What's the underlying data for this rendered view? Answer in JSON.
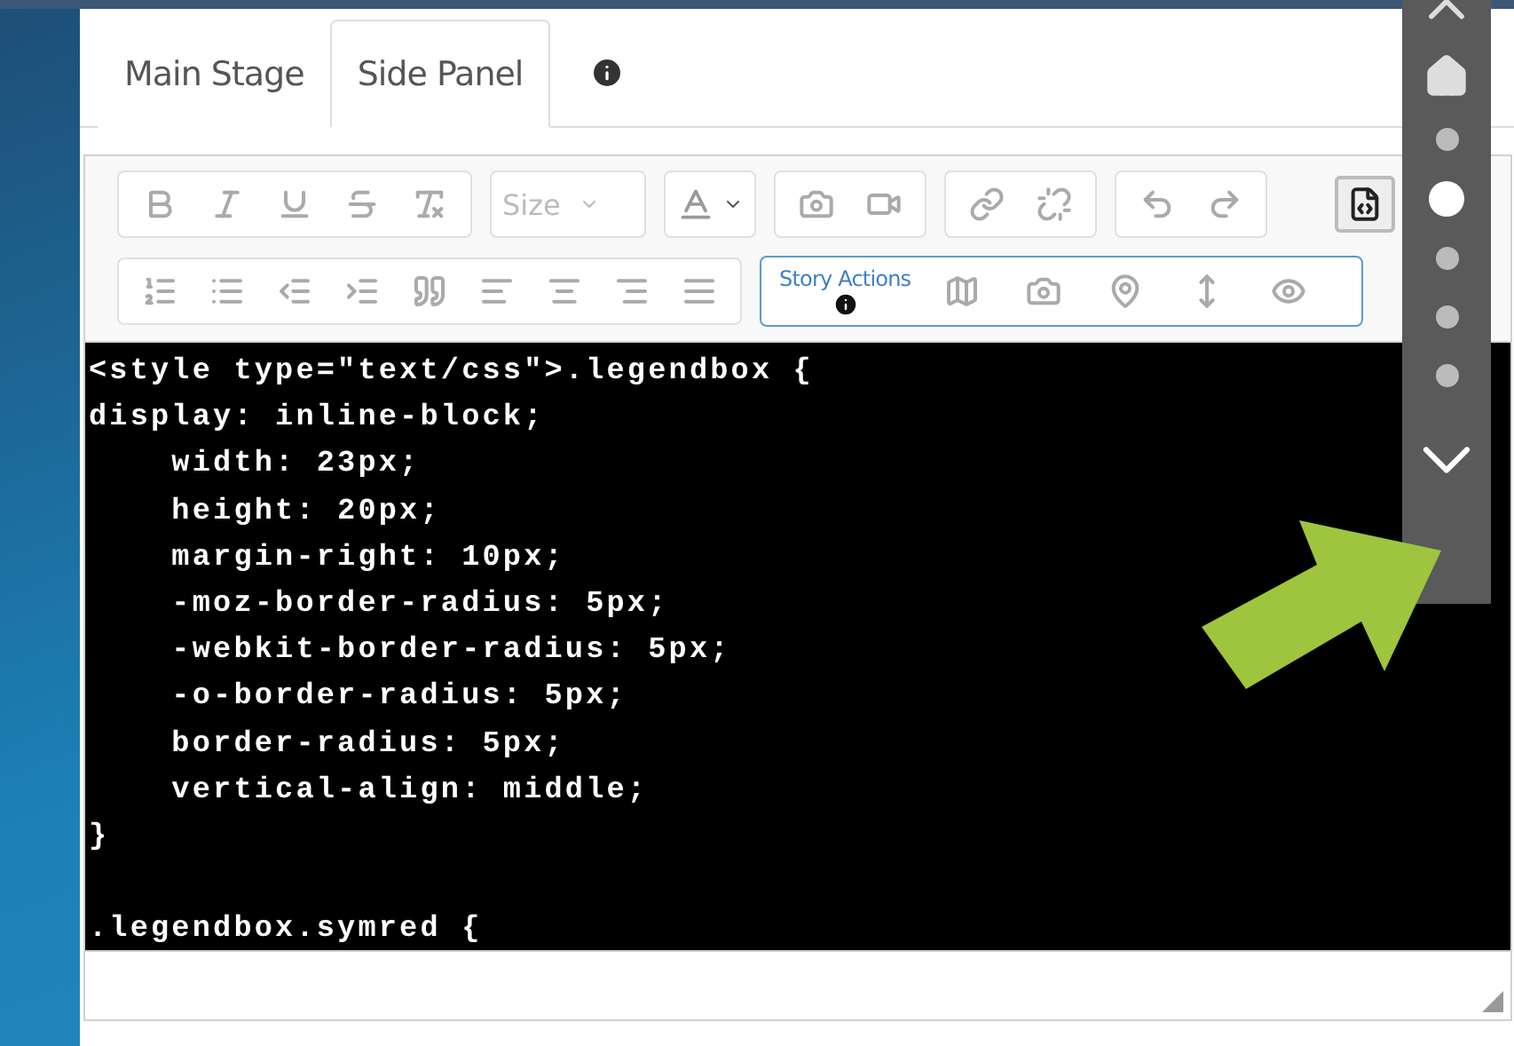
{
  "tabs": [
    {
      "label": "Main Stage",
      "selected": false
    },
    {
      "label": "Side Panel",
      "selected": true
    }
  ],
  "toolbar": {
    "size_placeholder": "Size",
    "source_mode_on": true,
    "story_actions": {
      "label": "Story Actions"
    }
  },
  "code_blocks": [
    [
      "<style type=\"text/css\">.legendbox {",
      "display: inline-block;",
      "    width: 23px;",
      "    height: 20px;",
      "    margin-right: 10px;",
      "    -moz-border-radius: 5px;",
      "    -webkit-border-radius: 5px;",
      "    -o-border-radius: 5px;",
      "    border-radius: 5px;",
      "    vertical-align: middle;",
      "}"
    ],
    [
      ".legendbox.symred {"
    ]
  ],
  "nav_dots": [
    {
      "selected": false
    },
    {
      "selected": true
    },
    {
      "selected": false
    },
    {
      "selected": false
    },
    {
      "selected": false
    }
  ]
}
